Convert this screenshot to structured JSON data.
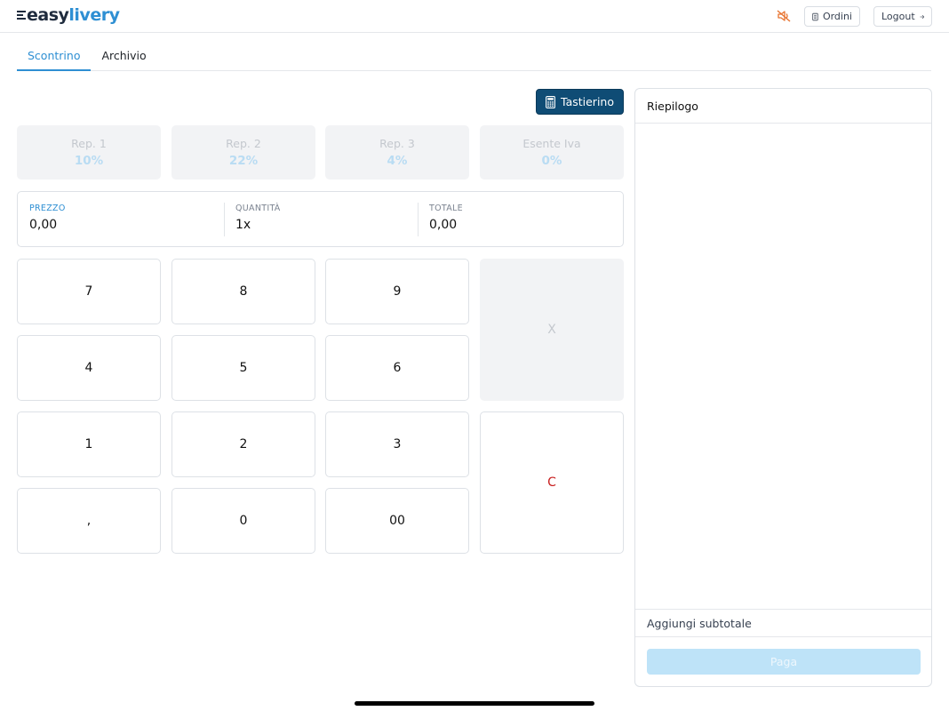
{
  "brand": {
    "easy": "easy",
    "livery": "livery"
  },
  "header": {
    "ordini_label": "Ordini",
    "logout_label": "Logout"
  },
  "tabs": [
    {
      "label": "Scontrino"
    },
    {
      "label": "Archivio"
    }
  ],
  "tastierino_label": "Tastierino",
  "reparti": [
    {
      "name": "Rep. 1",
      "rate": "10%"
    },
    {
      "name": "Rep. 2",
      "rate": "22%"
    },
    {
      "name": "Rep. 3",
      "rate": "4%"
    },
    {
      "name": "Esente Iva",
      "rate": "0%"
    }
  ],
  "display": {
    "prezzo_label": "PREZZO",
    "prezzo_value": "0,00",
    "quantita_label": "QUANTITÀ",
    "quantita_value": "1x",
    "totale_label": "TOTALE",
    "totale_value": "0,00"
  },
  "keypad": {
    "keys": [
      "7",
      "8",
      "9",
      "4",
      "5",
      "6",
      "1",
      "2",
      "3",
      ",",
      "0",
      "00"
    ],
    "x_label": "X",
    "c_label": "C"
  },
  "summary": {
    "title": "Riepilogo",
    "subtotal_label": "Aggiungi subtotale",
    "pay_label": "Paga"
  },
  "colors": {
    "accent": "#2e8fd3",
    "primary_button": "#0f4c75",
    "clear_key": "#c81e1e",
    "mute_icon": "#e8732f"
  },
  "icons": {
    "sound": "speaker-muted-icon",
    "ordini": "receipt-icon",
    "logout": "arrow-right-icon",
    "tastierino": "calculator-icon"
  }
}
